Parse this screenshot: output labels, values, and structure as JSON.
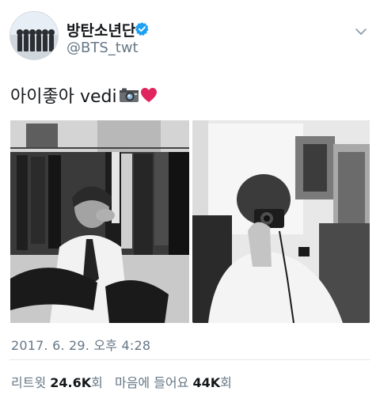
{
  "user": {
    "display_name": "방탄소년단",
    "handle": "@BTS_twt",
    "verified_icon": "verified-badge-icon",
    "verified_color": "#1da1f2"
  },
  "tweet": {
    "text": "아이좋아 vedi",
    "emojis": [
      "camera-icon",
      "red-heart-icon"
    ]
  },
  "media": {
    "photos": [
      "photo-1",
      "photo-2"
    ]
  },
  "timestamp": "2017. 6. 29. 오후 4:28",
  "stats": {
    "retweets_label": "리트윗",
    "retweets_value": "24.6K",
    "retweets_unit": "회",
    "likes_label": "마음에 들어요",
    "likes_value": "44K",
    "likes_unit": "회"
  },
  "colors": {
    "text_primary": "#14171a",
    "text_secondary": "#657786",
    "divider": "#e1e8ed",
    "heart": "#e0245e"
  }
}
